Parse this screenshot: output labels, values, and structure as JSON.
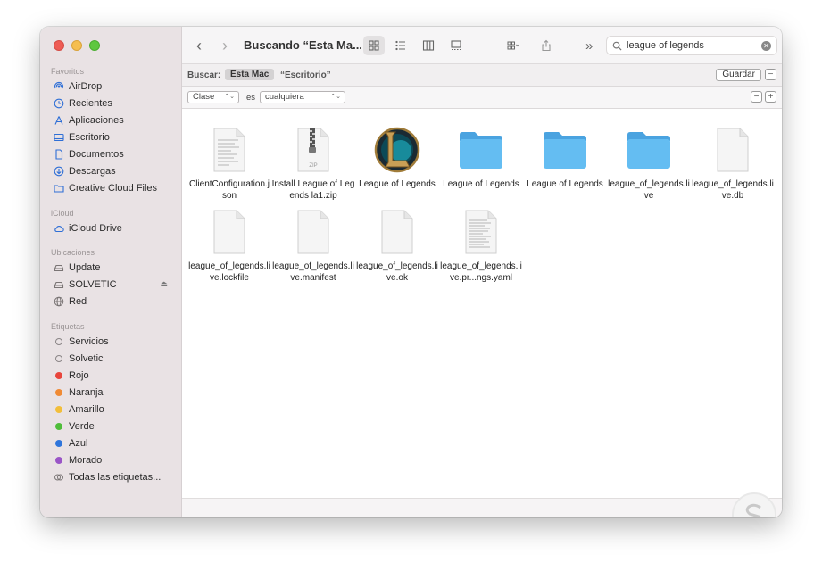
{
  "window": {
    "title": "Buscando “Esta Ma...",
    "search_value": "league of legends"
  },
  "sidebar": {
    "favorites_header": "Favoritos",
    "favorites": [
      {
        "label": "AirDrop",
        "icon": "airdrop-icon"
      },
      {
        "label": "Recientes",
        "icon": "clock-icon"
      },
      {
        "label": "Aplicaciones",
        "icon": "applications-icon"
      },
      {
        "label": "Escritorio",
        "icon": "desktop-icon"
      },
      {
        "label": "Documentos",
        "icon": "document-icon"
      },
      {
        "label": "Descargas",
        "icon": "download-icon"
      },
      {
        "label": "Creative Cloud Files",
        "icon": "folder-icon"
      }
    ],
    "icloud_header": "iCloud",
    "icloud": [
      {
        "label": "iCloud Drive",
        "icon": "cloud-icon"
      }
    ],
    "locations_header": "Ubicaciones",
    "locations": [
      {
        "label": "Update",
        "icon": "drive-icon"
      },
      {
        "label": "SOLVETIC",
        "icon": "drive-icon"
      },
      {
        "label": "Red",
        "icon": "network-icon"
      }
    ],
    "tags_header": "Etiquetas",
    "tags": [
      {
        "label": "Servicios",
        "color": "none"
      },
      {
        "label": "Solvetic",
        "color": "none"
      },
      {
        "label": "Rojo",
        "color": "#e8453c"
      },
      {
        "label": "Naranja",
        "color": "#f08a34"
      },
      {
        "label": "Amarillo",
        "color": "#f2be3a"
      },
      {
        "label": "Verde",
        "color": "#4fbd3a"
      },
      {
        "label": "Azul",
        "color": "#2f75db"
      },
      {
        "label": "Morado",
        "color": "#9a55c7"
      }
    ],
    "all_tags_label": "Todas las etiquetas..."
  },
  "scope": {
    "label": "Buscar:",
    "active": "Esta Mac",
    "other": "“Escritorio”",
    "save_label": "Guardar"
  },
  "rule": {
    "attribute": "Clase",
    "operator": "es",
    "value": "cualquiera"
  },
  "files": [
    {
      "name": "ClientConfiguration.json",
      "kind": "text-doc"
    },
    {
      "name": "Install League of Legends la1.zip",
      "kind": "zip",
      "badge": "ZIP"
    },
    {
      "name": "League of Legends",
      "kind": "app"
    },
    {
      "name": "League of Legends",
      "kind": "folder"
    },
    {
      "name": "League of Legends",
      "kind": "folder"
    },
    {
      "name": "league_of_legends.live",
      "kind": "folder"
    },
    {
      "name": "league_of_legends.live.db",
      "kind": "blank-doc"
    },
    {
      "name": "league_of_legends.live.lockfile",
      "kind": "blank-doc"
    },
    {
      "name": "league_of_legends.live.manifest",
      "kind": "blank-doc"
    },
    {
      "name": "league_of_legends.live.ok",
      "kind": "blank-doc"
    },
    {
      "name": "league_of_legends.live.pr...ngs.yaml",
      "kind": "text-doc"
    }
  ],
  "colors": {
    "accent": "#2f6fd6",
    "folder": "#5cb7ee",
    "sidebar_bg": "#e9e2e4"
  }
}
